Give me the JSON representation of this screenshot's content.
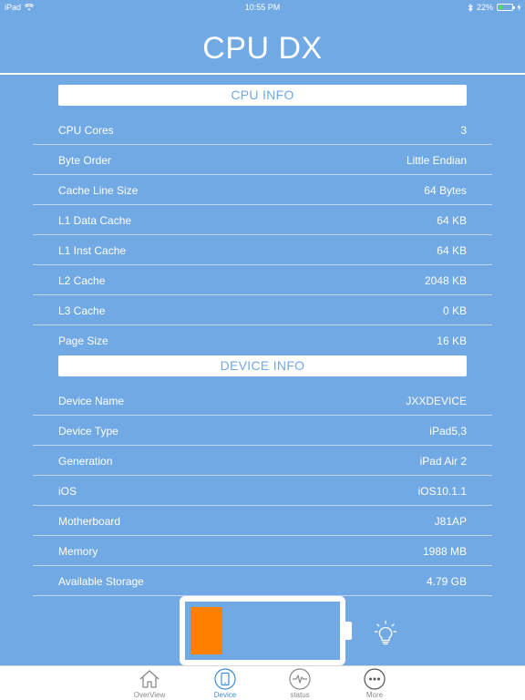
{
  "status_bar": {
    "device": "iPad",
    "time": "10:55 PM",
    "battery": "22%"
  },
  "app": {
    "title": "CPU DX"
  },
  "cpu_info": {
    "header": "CPU INFO",
    "rows": [
      {
        "label": "CPU Cores",
        "value": "3"
      },
      {
        "label": "Byte Order",
        "value": "Little Endian"
      },
      {
        "label": "Cache Line Size",
        "value": "64 Bytes"
      },
      {
        "label": "L1 Data Cache",
        "value": "64 KB"
      },
      {
        "label": "L1 Inst Cache",
        "value": "64 KB"
      },
      {
        "label": "L2 Cache",
        "value": "2048 KB"
      },
      {
        "label": "L3 Cache",
        "value": "0 KB"
      },
      {
        "label": "Page Size",
        "value": "16 KB"
      }
    ]
  },
  "device_info": {
    "header": "DEVICE INFO",
    "rows": [
      {
        "label": "Device Name",
        "value": "JXXDEVICE"
      },
      {
        "label": "Device Type",
        "value": "iPad5,3"
      },
      {
        "label": "Generation",
        "value": "iPad Air 2"
      },
      {
        "label": "iOS",
        "value": "iOS10.1.1"
      },
      {
        "label": "Motherboard",
        "value": "J81AP"
      },
      {
        "label": "Memory",
        "value": "1988 MB"
      },
      {
        "label": "Available Storage",
        "value": "4.79 GB"
      }
    ]
  },
  "battery_widget": {
    "level": 0.22,
    "fill_color": "#ff7f00",
    "icon": "lightbulb-icon"
  },
  "tabs": [
    {
      "label": "OverView",
      "icon": "home-icon",
      "active": false
    },
    {
      "label": "Device",
      "icon": "tablet-icon",
      "active": true
    },
    {
      "label": "status",
      "icon": "pulse-icon",
      "active": false
    },
    {
      "label": "More",
      "icon": "more-icon",
      "active": false
    }
  ],
  "colors": {
    "background": "#71a9e4",
    "accent": "#3e8edc",
    "battery_fill": "#ff7f00"
  }
}
